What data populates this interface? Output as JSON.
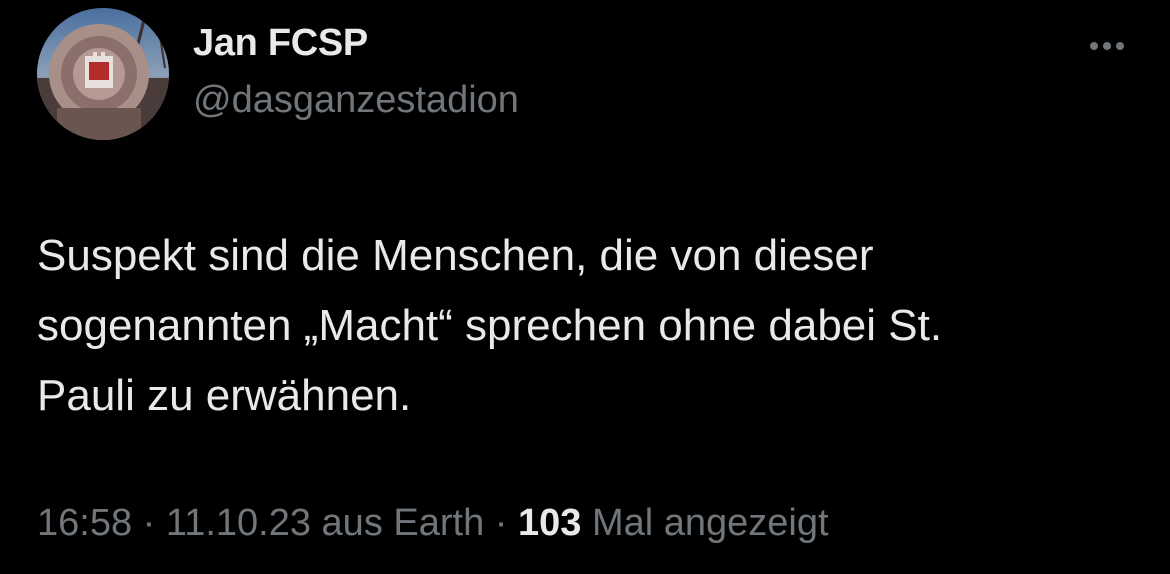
{
  "author": {
    "display_name": "Jan FCSP",
    "handle": "@dasganzestadion"
  },
  "more_icon": "more-horizontal-icon",
  "tweet": {
    "lines": [
      "Suspekt sind die Menschen, die von dieser",
      "sogenannten „Macht“ sprechen ohne dabei St.",
      "Pauli zu erwähnen."
    ]
  },
  "meta": {
    "time": "16:58",
    "separator": "·",
    "date": "11.10.23",
    "source": "aus Earth",
    "views_count": "103",
    "views_label": "Mal angezeigt"
  },
  "colors": {
    "background": "#000000",
    "primary_text": "#e7e9ea",
    "secondary_text": "#71767b"
  }
}
